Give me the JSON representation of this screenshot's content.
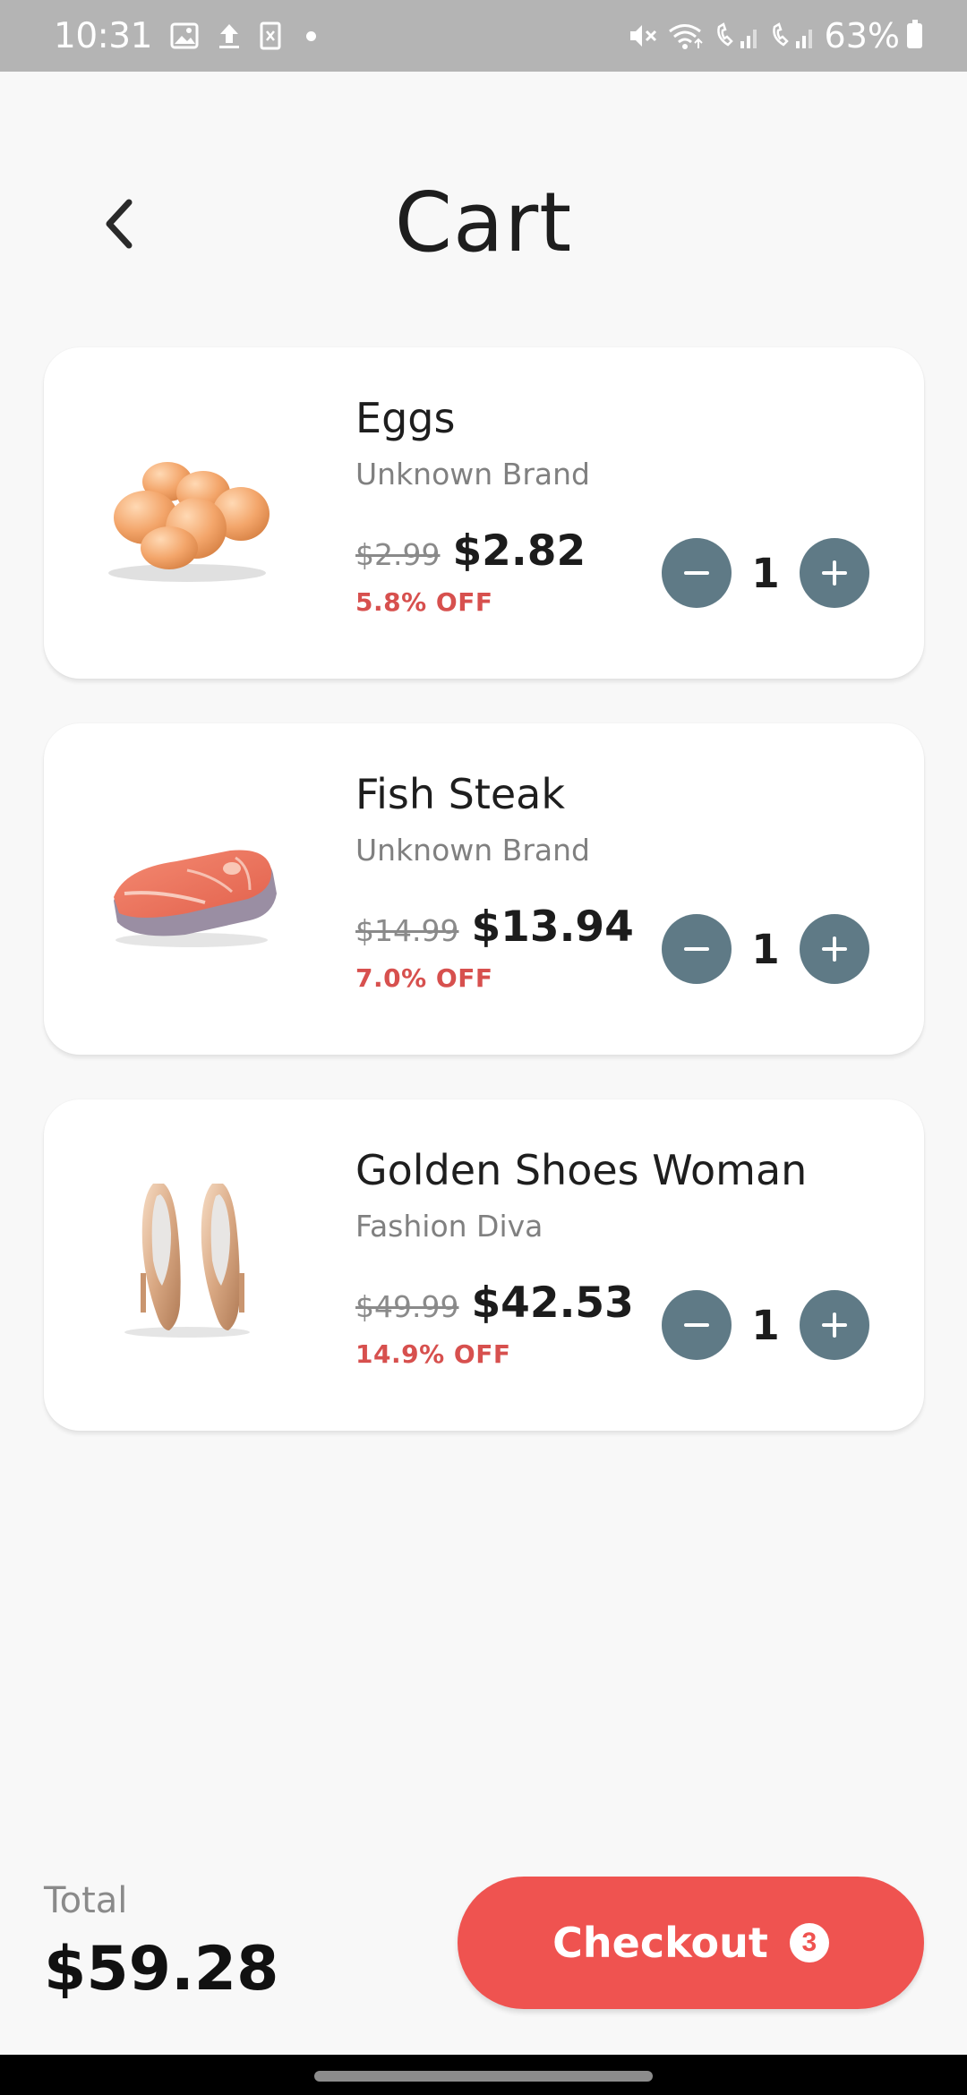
{
  "status_bar": {
    "time": "10:31",
    "battery": "63%",
    "left_icons": [
      "image-icon",
      "upload-icon",
      "sim-icon"
    ],
    "right_icons": [
      "mute-icon",
      "wifi-icon",
      "call-signal-1-icon",
      "call-signal-2-icon"
    ]
  },
  "header": {
    "title": "Cart",
    "back_icon": "chevron-left-icon"
  },
  "cart": {
    "items": [
      {
        "name": "Eggs",
        "brand": "Unknown Brand",
        "old_price": "$2.99",
        "price": "$2.82",
        "discount": "5.8% OFF",
        "quantity": "1",
        "image_icon": "eggs-image"
      },
      {
        "name": "Fish Steak",
        "brand": "Unknown Brand",
        "old_price": "$14.99",
        "price": "$13.94",
        "discount": "7.0% OFF",
        "quantity": "1",
        "image_icon": "fish-steak-image"
      },
      {
        "name": "Golden Shoes Woman",
        "brand": "Fashion Diva",
        "old_price": "$49.99",
        "price": "$42.53",
        "discount": "14.9% OFF",
        "quantity": "1",
        "image_icon": "golden-shoes-image"
      }
    ]
  },
  "footer": {
    "total_label": "Total",
    "total_value": "$59.28",
    "checkout_label": "Checkout",
    "checkout_badge": "3"
  },
  "colors": {
    "accent": "#ef5350",
    "discount": "#d7504e",
    "stepper": "#5f7a86",
    "background": "#f8f8f8",
    "status_bar": "#b4b4b4"
  }
}
